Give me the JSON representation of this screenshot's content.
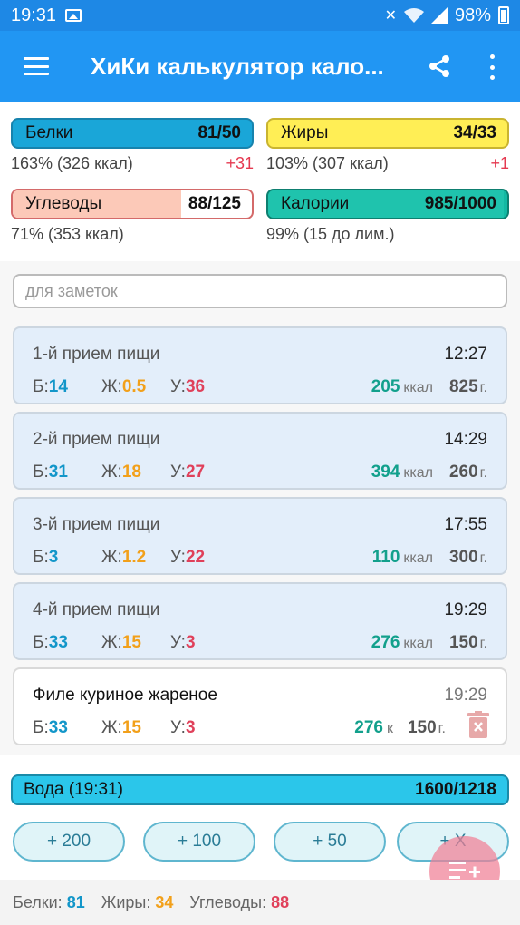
{
  "status_bar": {
    "time": "19:31",
    "battery": "98%"
  },
  "app_bar": {
    "title": "ХиКи калькулятор кало..."
  },
  "summary": {
    "protein": {
      "label": "Белки",
      "value": "81/50",
      "percent": "163% (326 ккал)",
      "delta": "+31"
    },
    "fat": {
      "label": "Жиры",
      "value": "34/33",
      "percent": "103% (307 ккал)",
      "delta": "+1"
    },
    "carbs": {
      "label": "Углеводы",
      "value": "88/125",
      "percent": "71% (353 ккал)"
    },
    "calories": {
      "label": "Калории",
      "value": "985/1000",
      "percent": "99% (15 до лим.)"
    }
  },
  "notes": {
    "placeholder": "для заметок"
  },
  "labels": {
    "p": "Б:",
    "f": "Ж:",
    "c": "У:",
    "kcal": "ккал",
    "kcal_short": "к",
    "grams": "г."
  },
  "meals": [
    {
      "name": "1-й прием пищи",
      "time": "12:27",
      "p": "14",
      "f": "0.5",
      "c": "36",
      "kcal": "205",
      "grams": "825"
    },
    {
      "name": "2-й прием пищи",
      "time": "14:29",
      "p": "31",
      "f": "18",
      "c": "27",
      "kcal": "394",
      "grams": "260"
    },
    {
      "name": "3-й прием пищи",
      "time": "17:55",
      "p": "3",
      "f": "1.2",
      "c": "22",
      "kcal": "110",
      "grams": "300"
    },
    {
      "name": "4-й прием пищи",
      "time": "19:29",
      "p": "33",
      "f": "15",
      "c": "3",
      "kcal": "276",
      "grams": "150"
    }
  ],
  "product": {
    "name": "Филе куриное жареное",
    "time": "19:29",
    "p": "33",
    "f": "15",
    "c": "3",
    "kcal": "276",
    "grams": "150"
  },
  "water": {
    "label": "Вода (19:31)",
    "value": "1600/1218",
    "buttons": [
      "+ 200",
      "+ 100",
      "+ 50",
      "+ X"
    ]
  },
  "totals": {
    "protein_label": "Белки:",
    "protein": "81",
    "fat_label": "Жиры:",
    "fat": "34",
    "carbs_label": "Углеводы:",
    "carbs": "88"
  },
  "colors": {
    "accent": "#2196f3",
    "protein": "#1aa6d8",
    "fat": "#ffee55",
    "carbs": "#fcc9b8",
    "calories": "#12b9a3",
    "water": "#2bc6ea"
  }
}
